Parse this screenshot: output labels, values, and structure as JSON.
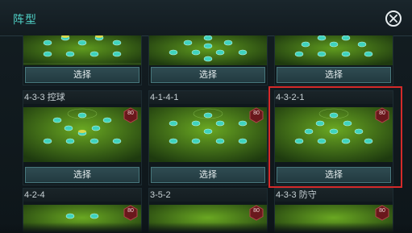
{
  "header": {
    "title": "阵型",
    "close_icon": "close-circle-icon"
  },
  "select_label": "选择",
  "rating_badge": "80",
  "colors": {
    "accent": "#4fd0c6",
    "highlight": "#d42a2a",
    "badge": "#7a1c20",
    "pitch": "#3d7a1a"
  },
  "formations": [
    {
      "name": "",
      "rating": ""
    },
    {
      "name": "",
      "rating": ""
    },
    {
      "name": "",
      "rating": ""
    },
    {
      "name": "4-3-3 控球",
      "rating": "80"
    },
    {
      "name": "4-1-4-1",
      "rating": "80"
    },
    {
      "name": "4-3-2-1",
      "rating": "80"
    },
    {
      "name": "4-2-4",
      "rating": "80"
    },
    {
      "name": "3-5-2",
      "rating": "80"
    },
    {
      "name": "4-3-3 防守",
      "rating": "80"
    }
  ]
}
